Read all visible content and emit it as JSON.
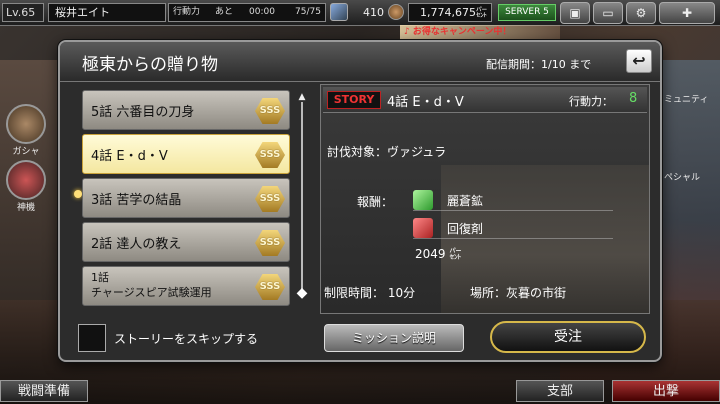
{
  "topbar": {
    "level": "Lv.65",
    "player_name": "桜井エイト",
    "stamina_label": "行動力",
    "stamina_ato": "あと",
    "stamina_timer": "00:00",
    "stamina_value": "75/75",
    "gems": "410",
    "money": "1,774,675",
    "money_unit": "㌫",
    "server": "SERVER 5",
    "campaign": "♪ お得なキャンペーン中！"
  },
  "side": {
    "gacha": "ガシャ",
    "shinki": "神機",
    "community": "ミュニティ",
    "special": "ペシャル"
  },
  "bottom_nav": {
    "battle_prep": "戦闘準備",
    "branch": "支部",
    "sortie": "出撃"
  },
  "modal": {
    "title": "極東からの贈り物",
    "period": "配信期間：1/10 まで",
    "back_icon": "↩"
  },
  "stories": [
    {
      "label": "5話 六番目の刀身",
      "rank": "SSS",
      "selected": false
    },
    {
      "label": "4話 E・d・V",
      "rank": "SSS",
      "selected": true
    },
    {
      "label": "3話 苦学の結晶",
      "rank": "SSS",
      "selected": false
    },
    {
      "label": "2話 達人の教え",
      "rank": "SSS",
      "selected": false
    },
    {
      "label_line1": "1話",
      "label_line2": "チャージスピア試験運用",
      "rank": "SSS",
      "selected": false
    }
  ],
  "detail": {
    "tag": "STORY",
    "title": "4話 E・d・V",
    "action_label": "行動力：",
    "action_value": "8",
    "target": "討伐対象：ヴァジュラ",
    "reward_label": "報酬：",
    "rewards": [
      {
        "name": "麗蒼鉱",
        "icon": "ore-icon",
        "color": "#4fc44f"
      },
      {
        "name": "回復剤",
        "icon": "potion-icon",
        "color": "#d33"
      }
    ],
    "money_reward": "2049 ㌫",
    "time_limit": "制限時間： 10分",
    "location": "場所：灰暮の市街"
  },
  "footer": {
    "skip_label": "ストーリーをスキップする",
    "mission_button": "ミッション説明",
    "accept_button": "受注"
  }
}
